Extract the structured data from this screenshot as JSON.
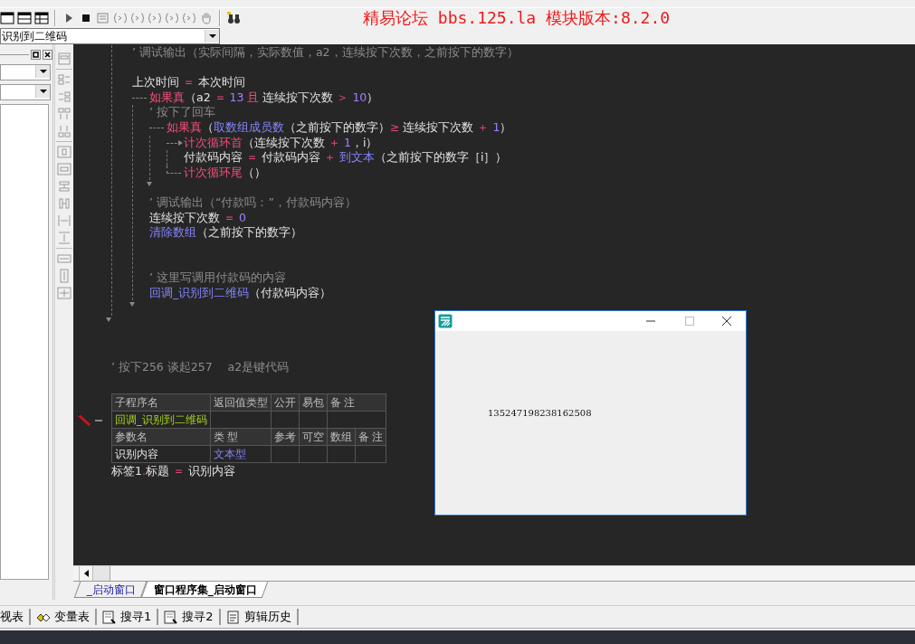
{
  "toolbar": {
    "banner": "精易论坛 bbs.125.la 模块版本:8.2.0"
  },
  "subroutine_combo": {
    "value": "识别到二维码"
  },
  "code": [
    {
      "kind": "line",
      "tokens": [
        {
          "kind": "comment",
          "text": "’ 调试输出（实际间隔，实际数值，a2，连续按下次数，之前按下的数字）"
        }
      ]
    },
    {
      "kind": "blank"
    },
    {
      "kind": "line",
      "tokens": [
        {
          "kind": "plain",
          "text": "上次时间 "
        },
        {
          "kind": "operator",
          "text": "＝"
        },
        {
          "kind": "plain",
          "text": " 本次时间"
        }
      ]
    },
    {
      "kind": "if",
      "tokens": [
        {
          "kind": "keyword",
          "text": "如果真"
        },
        {
          "kind": "plain",
          "text": "（a2 "
        },
        {
          "kind": "operator",
          "text": "＝"
        },
        {
          "kind": "number",
          "text": " 13 "
        },
        {
          "kind": "keyword",
          "text": "且"
        },
        {
          "kind": "plain",
          "text": " 连续按下次数 "
        },
        {
          "kind": "operator",
          "text": "＞"
        },
        {
          "kind": "number",
          "text": " 10"
        },
        {
          "kind": "plain",
          "text": "）"
        }
      ],
      "children": [
        {
          "kind": "line",
          "tokens": [
            {
              "kind": "comment",
              "text": "’ 按下了回车"
            }
          ]
        },
        {
          "kind": "if",
          "tokens": [
            {
              "kind": "keyword",
              "text": "如果真"
            },
            {
              "kind": "plain",
              "text": "（"
            },
            {
              "kind": "function",
              "text": "取数组成员数"
            },
            {
              "kind": "plain",
              "text": "（之前按下的数字）"
            },
            {
              "kind": "operator",
              "text": "≥"
            },
            {
              "kind": "plain",
              "text": " 连续按下次数 "
            },
            {
              "kind": "operator",
              "text": "＋"
            },
            {
              "kind": "number",
              "text": " 1"
            },
            {
              "kind": "plain",
              "text": "）"
            }
          ],
          "children": [
            {
              "kind": "loop",
              "tokens": [
                {
                  "kind": "keyword",
                  "text": "计次循环首"
                },
                {
                  "kind": "plain",
                  "text": "（连续按下次数 "
                },
                {
                  "kind": "operator",
                  "text": "＋"
                },
                {
                  "kind": "number",
                  "text": " 1"
                },
                {
                  "kind": "plain",
                  "text": "，i）"
                }
              ],
              "children": [
                {
                  "kind": "line",
                  "tokens": [
                    {
                      "kind": "plain",
                      "text": "付款码内容 "
                    },
                    {
                      "kind": "operator",
                      "text": "＝"
                    },
                    {
                      "kind": "plain",
                      "text": " 付款码内容 "
                    },
                    {
                      "kind": "operator",
                      "text": "＋"
                    },
                    {
                      "kind": "function",
                      "text": " 到文本"
                    },
                    {
                      "kind": "plain",
                      "text": "（之前按下的数字［i］）"
                    }
                  ]
                }
              ],
              "end_tokens": [
                {
                  "kind": "keyword",
                  "text": "计次循环尾"
                },
                {
                  "kind": "plain",
                  "text": "（）"
                }
              ]
            }
          ]
        },
        {
          "kind": "line",
          "tokens": [
            {
              "kind": "comment",
              "text": "’ 调试输出（“付款吗：”，付款码内容）"
            }
          ]
        },
        {
          "kind": "line",
          "tokens": [
            {
              "kind": "plain",
              "text": "连续按下次数 "
            },
            {
              "kind": "operator",
              "text": "＝"
            },
            {
              "kind": "number",
              "text": " 0"
            }
          ]
        },
        {
          "kind": "line",
          "tokens": [
            {
              "kind": "function",
              "text": "清除数组"
            },
            {
              "kind": "plain",
              "text": "（之前按下的数字）"
            }
          ]
        },
        {
          "kind": "blank"
        },
        {
          "kind": "blank"
        },
        {
          "kind": "line",
          "tokens": [
            {
              "kind": "comment",
              "text": "’ 这里写调用付款码的内容"
            }
          ]
        },
        {
          "kind": "line",
          "tokens": [
            {
              "kind": "function",
              "text": "回调_识别到二维码"
            },
            {
              "kind": "plain",
              "text": "（付款码内容）"
            }
          ]
        }
      ]
    }
  ],
  "after_code": [
    {
      "kind": "blank"
    },
    {
      "kind": "blank"
    },
    {
      "kind": "line",
      "tokens": [
        {
          "kind": "comment",
          "text": "’ 按下256 谈起257　 a2是键代码"
        }
      ]
    }
  ],
  "sub_table": {
    "header": [
      "子程序名",
      "返回值类型",
      "公开",
      "易包",
      "备 注"
    ],
    "sub_name": "回调_识别到二维码",
    "param_header": [
      "参数名",
      "类 型",
      "参考",
      "可空",
      "数组",
      "备 注"
    ],
    "params": [
      {
        "name": "识别内容",
        "type": "文本型"
      }
    ]
  },
  "after_table": [
    {
      "kind": "line",
      "tokens": [
        {
          "kind": "plain",
          "text": "标签1"
        },
        {
          "kind": "operator",
          "text": "."
        },
        {
          "kind": "plain",
          "text": "标题 "
        },
        {
          "kind": "operator",
          "text": "＝"
        },
        {
          "kind": "plain",
          "text": " 识别内容"
        }
      ]
    }
  ],
  "editor_tabs": [
    {
      "label": "_启动窗口",
      "selected": false
    },
    {
      "label": "窗口程序集_启动窗口",
      "selected": true
    }
  ],
  "bottom_tabs": [
    {
      "label": "视表"
    },
    {
      "label": "变量表"
    },
    {
      "label": "搜寻1"
    },
    {
      "label": "搜寻2"
    },
    {
      "label": "剪辑历史"
    }
  ],
  "popup": {
    "text": "135247198238162508"
  }
}
